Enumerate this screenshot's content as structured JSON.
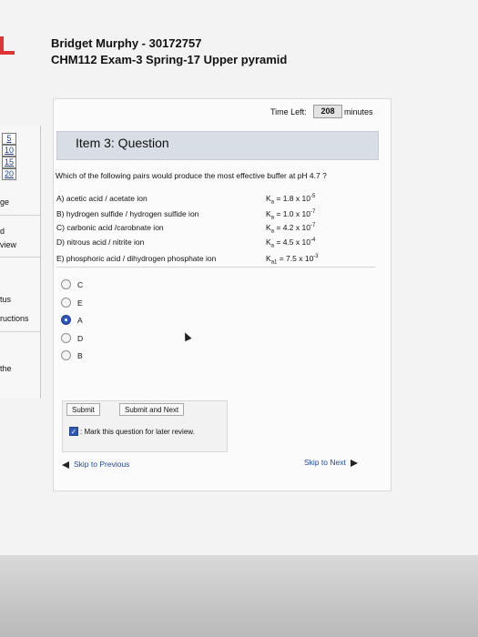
{
  "header": {
    "name": "Bridget Murphy - 30172757",
    "exam": "CHM112 Exam-3 Spring-17 Upper pyramid"
  },
  "sidebar": {
    "question_numbers": [
      "5",
      "10",
      "15",
      "20"
    ],
    "fragments": [
      "ge",
      "d",
      "view",
      "tus",
      "ructions",
      "the"
    ]
  },
  "timer": {
    "label": "Time Left:",
    "value": "208",
    "unit": "minutes"
  },
  "item": {
    "title": "Item 3: Question",
    "question": "Which of the following pairs would produce the most effective buffer at pH 4.7 ?"
  },
  "choices": [
    {
      "label": "A) acetic acid / acetate ion",
      "ka_symbol": "K",
      "ka_sub": "a",
      "ka_value": " = 1.8 x 10",
      "ka_exp": "-5"
    },
    {
      "label": "B) hydrogen sulfide / hydrogen sulfide ion",
      "ka_symbol": "K",
      "ka_sub": "a",
      "ka_value": " = 1.0 x 10",
      "ka_exp": "-7"
    },
    {
      "label": "C) carbonic acid /carobnate ion",
      "ka_symbol": "K",
      "ka_sub": "a",
      "ka_value": " = 4.2 x 10",
      "ka_exp": "-7"
    },
    {
      "label": "D) nitrous acid / nitrite ion",
      "ka_symbol": "K",
      "ka_sub": "a",
      "ka_value": " = 4.5 x 10",
      "ka_exp": "-4"
    },
    {
      "label": "E) phosphoric acid / dihydrogen phosphate ion",
      "ka_symbol": "K",
      "ka_sub": "a1",
      "ka_value": " = 7.5 x 10",
      "ka_exp": "-3"
    }
  ],
  "answers": [
    {
      "label": "C",
      "selected": false
    },
    {
      "label": "E",
      "selected": false
    },
    {
      "label": "A",
      "selected": true
    },
    {
      "label": "D",
      "selected": false
    },
    {
      "label": "B",
      "selected": false
    }
  ],
  "buttons": {
    "submit": "Submit",
    "submit_next": "Submit and Next",
    "review_mark": ": Mark this question for later review.",
    "review_checked": true
  },
  "nav": {
    "prev": "Skip to Previous",
    "next": "Skip to Next"
  },
  "colors": {
    "accent": "#2d58b8",
    "item_bar": "#d8dee6",
    "link": "#1d4a9e",
    "logo": "#dd3333"
  }
}
